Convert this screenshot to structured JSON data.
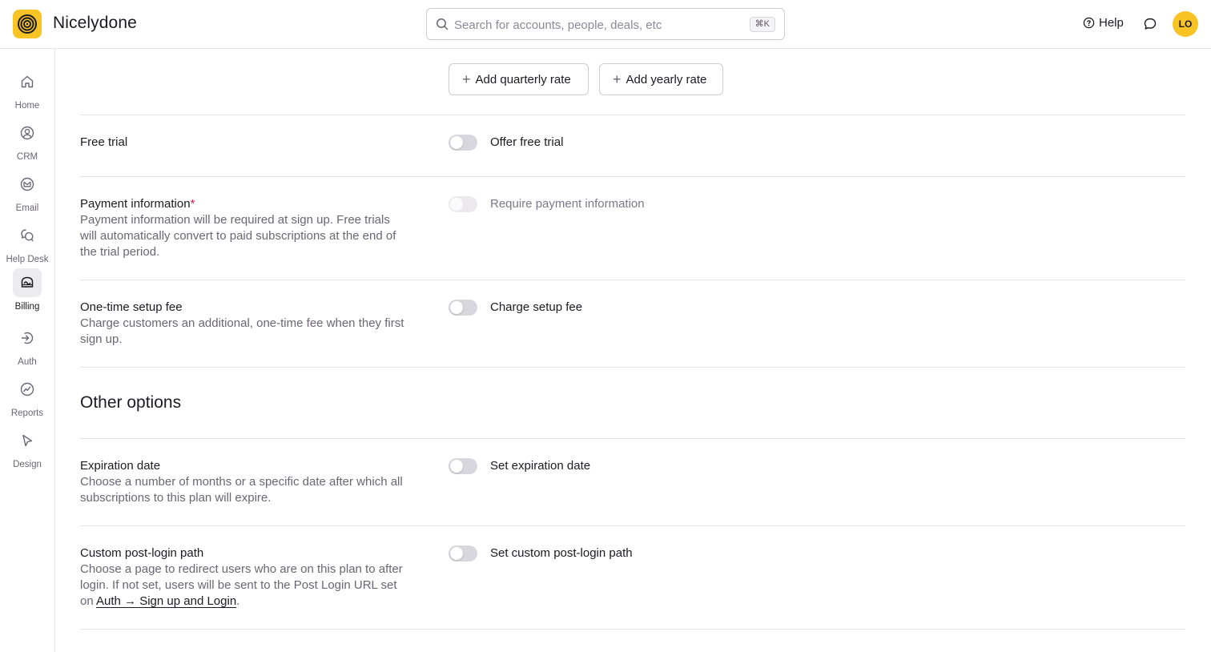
{
  "app": {
    "name": "Nicelydone",
    "search_placeholder": "Search for accounts, people, deals, etc",
    "search_shortcut": "⌘K",
    "help_label": "Help",
    "avatar_initials": "LO",
    "accent_color": "#f7c325"
  },
  "sidebar": {
    "items": [
      {
        "label": "Home",
        "icon": "home-icon"
      },
      {
        "label": "CRM",
        "icon": "user-circle-icon"
      },
      {
        "label": "Email",
        "icon": "mail-icon"
      },
      {
        "label": "Help Desk",
        "icon": "chat-bubbles-icon"
      },
      {
        "label": "Billing",
        "icon": "billing-icon",
        "active": true
      },
      {
        "label": "Auth",
        "icon": "login-icon"
      },
      {
        "label": "Reports",
        "icon": "chart-icon"
      },
      {
        "label": "Design",
        "icon": "cursor-icon"
      }
    ]
  },
  "rates": {
    "add_quarterly": "Add quarterly rate",
    "add_yearly": "Add yearly rate"
  },
  "settings": {
    "free_trial": {
      "title": "Free trial",
      "toggle_label": "Offer free trial",
      "enabled": false
    },
    "payment_info": {
      "title": "Payment information",
      "required_mark": "*",
      "description": "Payment information will be required at sign up. Free trials will automatically convert to paid subscriptions at the end of the trial period.",
      "toggle_label": "Require payment information",
      "enabled": false,
      "disabled": true
    },
    "setup_fee": {
      "title": "One-time setup fee",
      "description": "Charge customers an additional, one-time fee when they first sign up.",
      "toggle_label": "Charge setup fee",
      "enabled": false
    }
  },
  "other_options": {
    "heading": "Other options",
    "expiration": {
      "title": "Expiration date",
      "description": "Choose a number of months or a specific date after which all subscriptions to this plan will expire.",
      "toggle_label": "Set expiration date",
      "enabled": false
    },
    "post_login": {
      "title": "Custom post-login path",
      "description_prefix": "Choose a page to redirect users who are on this plan to after login. If not set, users will be sent to the Post Login URL set on",
      "link_text": "Auth → Sign up and Login",
      "description_suffix": ".",
      "toggle_label": "Set custom post-login path",
      "enabled": false
    }
  }
}
